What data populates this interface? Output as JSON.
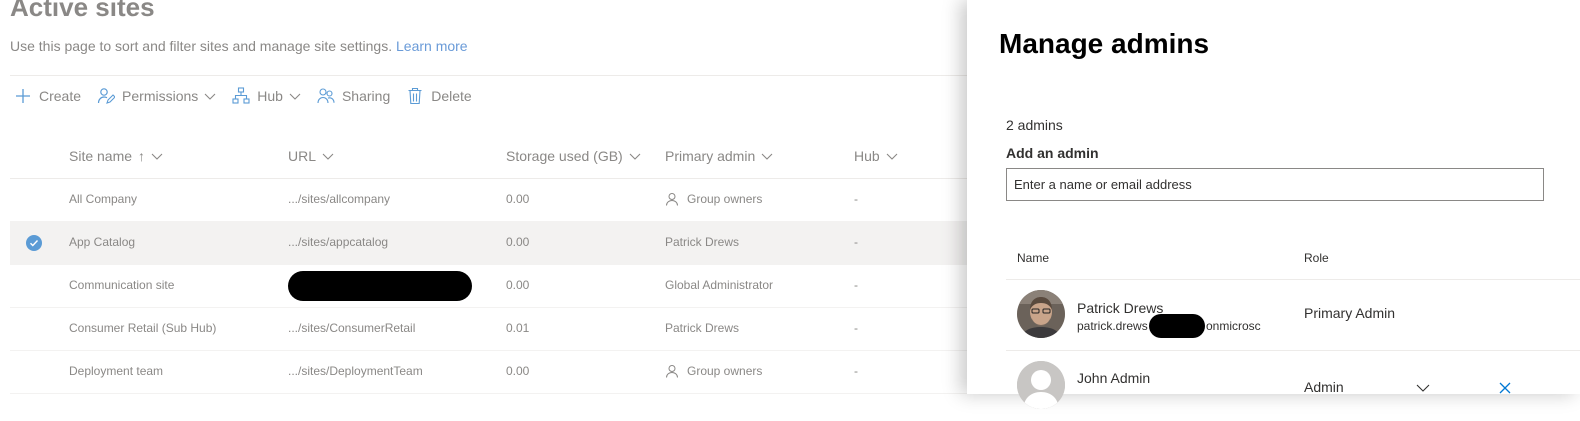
{
  "page": {
    "title": "Active sites",
    "subtitle": "Use this page to sort and filter sites and manage site settings.",
    "learn_more": "Learn more"
  },
  "commands": [
    {
      "label": "Create",
      "icon": "plus-icon"
    },
    {
      "label": "Permissions",
      "icon": "permissions-icon",
      "dropdown": true
    },
    {
      "label": "Hub",
      "icon": "hub-icon",
      "dropdown": true
    },
    {
      "label": "Sharing",
      "icon": "sharing-icon"
    },
    {
      "label": "Delete",
      "icon": "trash-icon"
    }
  ],
  "table": {
    "columns": [
      "Site name",
      "URL",
      "Storage used (GB)",
      "Primary admin",
      "Hub"
    ],
    "sort_indicator": "↑",
    "rows": [
      {
        "name": "All Company",
        "url": ".../sites/allcompany",
        "storage": "0.00",
        "admin": "Group owners",
        "admin_icon": true,
        "hub": "-",
        "selected": false,
        "url_redacted": false
      },
      {
        "name": "App Catalog",
        "url": ".../sites/appcatalog",
        "storage": "0.00",
        "admin": "Patrick Drews",
        "admin_icon": false,
        "hub": "-",
        "selected": true,
        "url_redacted": false
      },
      {
        "name": "Communication site",
        "url": "",
        "storage": "0.00",
        "admin": "Global Administrator",
        "admin_icon": false,
        "hub": "-",
        "selected": false,
        "url_redacted": true
      },
      {
        "name": "Consumer Retail (Sub Hub)",
        "url": ".../sites/ConsumerRetail",
        "storage": "0.01",
        "admin": "Patrick Drews",
        "admin_icon": false,
        "hub": "-",
        "selected": false,
        "url_redacted": false
      },
      {
        "name": "Deployment team",
        "url": ".../sites/DeploymentTeam",
        "storage": "0.00",
        "admin": "Group owners",
        "admin_icon": true,
        "hub": "-",
        "selected": false,
        "url_redacted": false
      }
    ]
  },
  "panel": {
    "title": "Manage admins",
    "admins_count": "2 admins",
    "add_label": "Add an admin",
    "add_placeholder": "Enter a name or email address",
    "columns": {
      "name": "Name",
      "role": "Role"
    },
    "admins": [
      {
        "name": "Patrick Drews",
        "email_prefix": "patrick.drews",
        "email_suffix": "onmicrosc",
        "role": "Primary Admin",
        "removable": false
      },
      {
        "name": "John Admin",
        "email_prefix": "",
        "email_suffix": "",
        "role": "Admin",
        "removable": true
      }
    ]
  },
  "colors": {
    "accent": "#0078d4",
    "check": "#5b9bd5",
    "text": "#323130",
    "muted": "#8a8886"
  }
}
